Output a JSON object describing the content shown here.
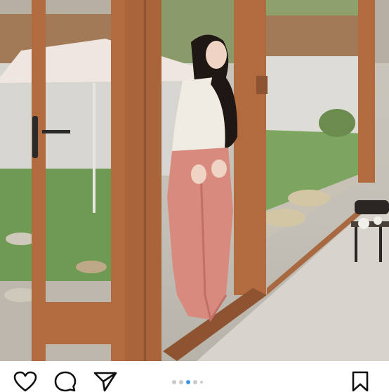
{
  "post": {
    "image": {
      "kind": "photo",
      "subject": "woman-standing-at-glass-door",
      "palette": {
        "wood_frame": "#b26b3e",
        "pants": "#d98a7e",
        "top": "#f1ece3",
        "hair": "#1e1714",
        "lawn": "#6f9a54",
        "wall": "#dedcd6",
        "canopy": "#efe6e2",
        "floor": "#d8d4cd"
      }
    },
    "carousel": {
      "total": 5,
      "active_index": 1,
      "active_color": "#3897f0",
      "inactive_color": "#c9c9c9"
    },
    "actions": {
      "like_icon": "heart-icon",
      "comment_icon": "comment-icon",
      "share_icon": "send-icon",
      "save_icon": "bookmark-icon"
    }
  }
}
